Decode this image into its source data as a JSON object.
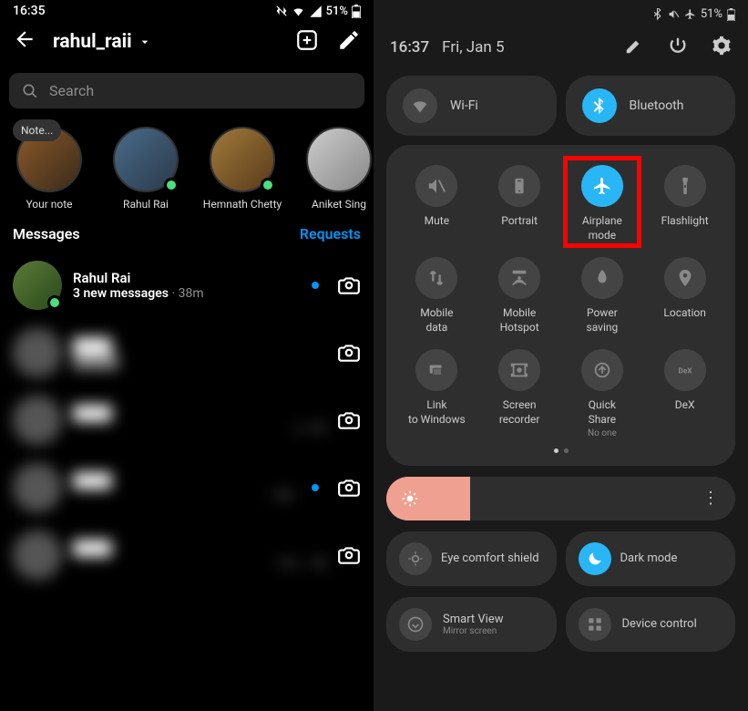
{
  "left": {
    "status": {
      "time": "16:35",
      "battery": "51%"
    },
    "header": {
      "username": "rahul_raii"
    },
    "search": {
      "placeholder": "Search"
    },
    "stories": [
      {
        "label": "Your note",
        "note": "Note...",
        "online": false
      },
      {
        "label": "Rahul Rai",
        "online": true
      },
      {
        "label": "Hemnath Chetty",
        "online": true
      },
      {
        "label": "Aniket Sing",
        "online": false
      }
    ],
    "tabs": {
      "messages": "Messages",
      "requests": "Requests"
    },
    "conversations": [
      {
        "name": "Rahul Rai",
        "subtitle": "3 new messages",
        "time": "38m",
        "unread": true,
        "online": true
      },
      {
        "name": "",
        "subtitle": "",
        "time": "",
        "blurred": true
      },
      {
        "name": "",
        "subtitle": "e",
        "time": "6h",
        "blurred": true
      },
      {
        "name": "",
        "subtitle": "",
        "time": "19h",
        "unread": true,
        "blurred": true
      },
      {
        "name": "",
        "subtitle": "d w…",
        "time": "3d",
        "blurred": true
      }
    ]
  },
  "right": {
    "status": {
      "battery": "51%"
    },
    "header": {
      "time": "16:37",
      "date": "Fri, Jan 5"
    },
    "wide_tiles": [
      {
        "label": "Wi-Fi",
        "icon": "wifi",
        "on": false
      },
      {
        "label": "Bluetooth",
        "icon": "bluetooth",
        "on": true
      }
    ],
    "qs": [
      {
        "label": "Mute",
        "icon": "mute",
        "on": false
      },
      {
        "label": "Portrait",
        "icon": "portrait",
        "on": false
      },
      {
        "label": "Airplane mode",
        "icon": "airplane",
        "on": true,
        "highlighted": true
      },
      {
        "label": "Flashlight",
        "icon": "flashlight",
        "on": false
      },
      {
        "label": "Mobile data",
        "icon": "mobiledata",
        "on": false
      },
      {
        "label": "Mobile Hotspot",
        "icon": "hotspot",
        "on": false
      },
      {
        "label": "Power saving",
        "icon": "powersaving",
        "on": false
      },
      {
        "label": "Location",
        "icon": "location",
        "on": false
      },
      {
        "label": "Link to Windows",
        "icon": "link",
        "on": false
      },
      {
        "label": "Screen recorder",
        "icon": "recorder",
        "on": false
      },
      {
        "label": "Quick Share",
        "sublabel": "No one",
        "icon": "quickshare",
        "on": false
      },
      {
        "label": "DeX",
        "icon": "dex",
        "on": false
      }
    ],
    "brightness": {
      "percent": 24
    },
    "modes": [
      {
        "label": "Eye comfort shield",
        "icon": "eye",
        "on": false
      },
      {
        "label": "Dark mode",
        "icon": "moon",
        "on": true
      }
    ],
    "bottom": [
      {
        "label": "Smart View",
        "sublabel": "Mirror screen",
        "icon": "smartview"
      },
      {
        "label": "Device control",
        "icon": "devicecontrol"
      }
    ]
  }
}
